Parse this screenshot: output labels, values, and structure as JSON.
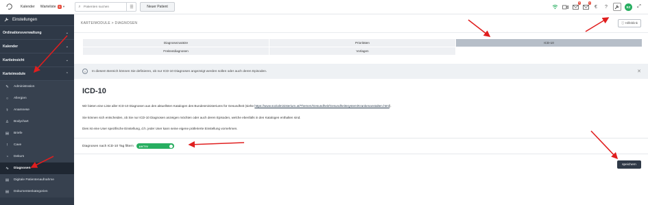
{
  "topbar": {
    "calendar_label": "Kalender",
    "waitlist_label": "Warteliste",
    "waitlist_count": "6",
    "search_placeholder": "Patienten suchen",
    "new_patient_label": "Neuer Patient",
    "mail_badge": "9",
    "mail2_badge": "4",
    "avatar_initials": "EZ"
  },
  "sidebar": {
    "title": "Einstellungen",
    "sections": [
      {
        "label": "Ordinationsverwaltung"
      },
      {
        "label": "Kalender"
      },
      {
        "label": "Kartieinsicht"
      },
      {
        "label": "Karteimodule"
      }
    ],
    "items": [
      {
        "label": "Administration",
        "icon": "pen-icon"
      },
      {
        "label": "Allergien",
        "icon": "circle-icon"
      },
      {
        "label": "Anamnese",
        "icon": "stethoscope-icon"
      },
      {
        "label": "Bodychart",
        "icon": "person-icon"
      },
      {
        "label": "Briefe",
        "icon": "document-icon"
      },
      {
        "label": "Cave",
        "icon": "exclamation-icon"
      },
      {
        "label": "Dekurs",
        "icon": "circle-icon"
      },
      {
        "label": "Diagnosen",
        "icon": "heartbeat-icon"
      },
      {
        "label": "Digitale Patientenaufnahme",
        "icon": "document-icon"
      },
      {
        "label": "Dokumentenkategorien",
        "icon": "document-icon"
      }
    ]
  },
  "main": {
    "breadcrumb": "KARTEIMODULE > DIAGNOSEN",
    "help_label": "Hilfeblink",
    "tabs": [
      {
        "label": "Diagnosezusätze"
      },
      {
        "label": "Prioritäten"
      },
      {
        "label": "ICD-10"
      },
      {
        "label": "Freitextdiagnosen"
      },
      {
        "label": "Vorlagen"
      }
    ],
    "info_text": "In diesem Bereich können Sie definieren, ob nur ICD-10 Diagnosen angezeigt werden sollen oder auch deren Episoden.",
    "heading": "ICD-10",
    "para1_pre": "Wir bieten eine Liste aller ICD-10 Diagnosen aus den aktuellsten Katalogen des Bundesministeriums für Gesundheit (siehe ",
    "para1_link": "https://www.sozialministerium.at/Themen/Gesundheit/Gesundheitssystem/Krankenanstalten.html",
    "para1_post": ").",
    "para2": "Sie können sich entscheiden, ob Sie nur ICD-10 Diagnosen anzeigen möchten oder auch deren Episoden, welche ebenfalls in den Katalogen enthalten sind.",
    "para3": "Dies ist eine User spezifische Einstellung, d.h. jeder User kann seine eigene präferierte Einstellung vornehmen.",
    "filter_label": "Diagnosen nach ICD-10 Tag filtern",
    "toggle_label": "AKTIV",
    "save_label": "speichern"
  },
  "colors": {
    "sidebar_bg": "#2f3947",
    "accent_green": "#27ae60",
    "annotation_red": "#e01e1e"
  }
}
